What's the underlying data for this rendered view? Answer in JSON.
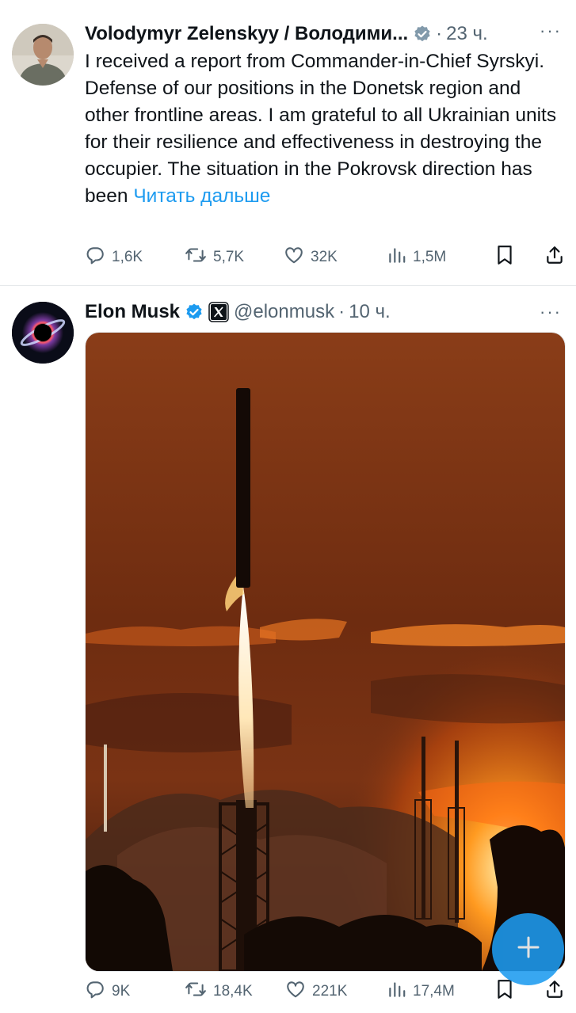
{
  "tweets": [
    {
      "author_name": "Volodymyr Zelenskyy / Володими...",
      "time": "23 ч.",
      "more": "···",
      "text_lines": [
        "I received a report from Commander-in-Chief Syrskyi.",
        "Defense of our positions in the Donetsk region and other frontline areas. I am grateful to all Ukrainian units for their resilience and effectiveness in destroying the occupier. The situation in the Pokrovsk direction has been"
      ],
      "read_more": "Читать дальше",
      "stats": {
        "replies": "1,6K",
        "reposts": "5,7K",
        "likes": "32K",
        "views": "1,5M"
      },
      "badge_color": "#829aab"
    },
    {
      "author_name": "Elon Musk",
      "handle": "@elonmusk",
      "time": "10 ч.",
      "more": "···",
      "stats": {
        "replies": "9K",
        "reposts": "18,4K",
        "likes": "221K",
        "views": "17,4M"
      },
      "badge_color": "#1d9bf0"
    }
  ],
  "icons": {
    "reply": "reply-icon",
    "repost": "repost-icon",
    "like": "heart-icon",
    "views": "views-icon",
    "bookmark": "bookmark-icon",
    "share": "share-icon",
    "compose": "plus-icon",
    "x_logo": "x-logo-icon"
  },
  "colors": {
    "accent": "#1d9bf0",
    "muted": "#536471",
    "text": "#0f1419"
  }
}
